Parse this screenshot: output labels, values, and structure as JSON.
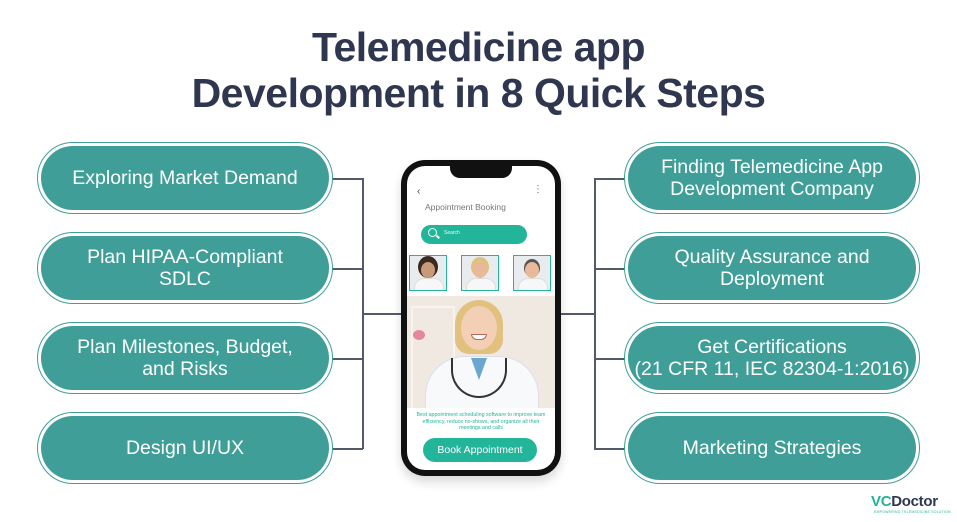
{
  "title": {
    "line1": "Telemedicine app",
    "line2": "Development in 8 Quick Steps"
  },
  "steps_left": [
    {
      "label": "Exploring Market Demand"
    },
    {
      "label": "Plan HIPAA-Compliant\nSDLC"
    },
    {
      "label": "Plan Milestones, Budget,\nand Risks"
    },
    {
      "label": "Design UI/UX"
    }
  ],
  "steps_right": [
    {
      "label": "Finding Telemedicine App\nDevelopment Company"
    },
    {
      "label": "Quality Assurance and\nDeployment"
    },
    {
      "label": "Get Certifications\n(21 CFR 11, IEC 82304-1:2016)"
    },
    {
      "label": "Marketing Strategies"
    }
  ],
  "phone": {
    "back_icon": "‹",
    "menu_icon": "⋮",
    "screen_title": "Appointment Booking",
    "search_placeholder": "Search",
    "doctor_thumbnails": [
      "doctor-female-glasses",
      "doctor-female-blonde",
      "doctor-male"
    ],
    "description": "Best appointment scheduling software to improve team efficiency, reduce no-shows, and organize all their meetings and calls",
    "book_button": "Book Appointment"
  },
  "logo": {
    "brand_prefix": "VC",
    "brand_suffix": "Doctor",
    "tagline": "EMPOWERING TELEMEDICINE SOLUTION"
  },
  "colors": {
    "pill_fill": "#3f9e98",
    "title": "#2f3650",
    "accent": "#22b59a",
    "connector": "#555a6a"
  }
}
